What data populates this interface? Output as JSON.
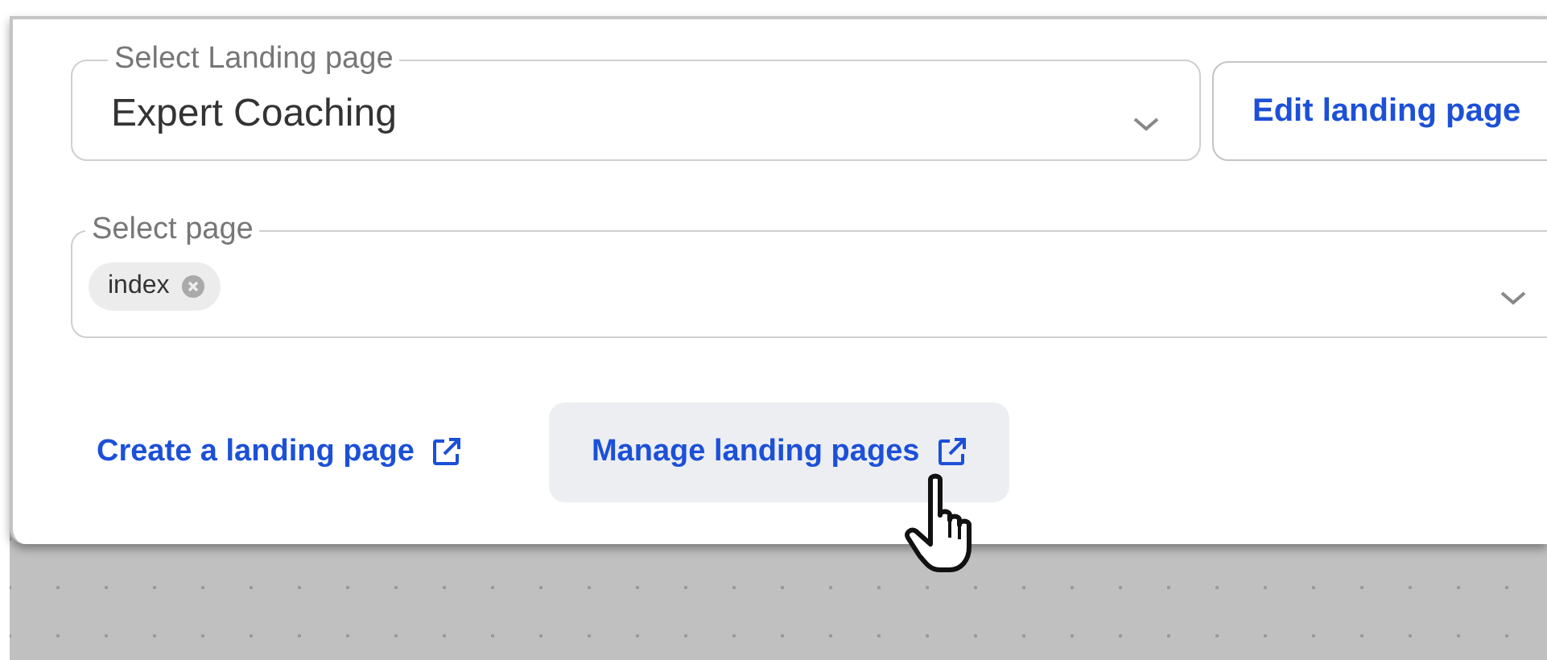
{
  "landing_select": {
    "label": "Select Landing page",
    "value": "Expert Coaching"
  },
  "edit_button": {
    "label": "Edit landing page"
  },
  "page_select": {
    "label": "Select page",
    "chips": [
      "index"
    ]
  },
  "links": [
    {
      "label": "Create a landing page",
      "hovered": false
    },
    {
      "label": "Manage landing pages",
      "hovered": true
    }
  ]
}
